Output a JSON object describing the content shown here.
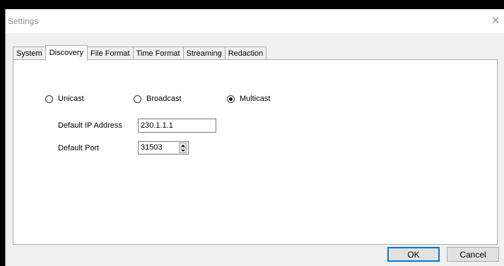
{
  "window": {
    "title": "Settings",
    "close_glyph": "✕"
  },
  "tabs": [
    {
      "label": "System",
      "active": false
    },
    {
      "label": "Discovery",
      "active": true
    },
    {
      "label": "File Format",
      "active": false
    },
    {
      "label": "Time Format",
      "active": false
    },
    {
      "label": "Streaming",
      "active": false
    },
    {
      "label": "Redaction",
      "active": false
    }
  ],
  "discovery": {
    "modes": [
      {
        "label": "Unicast",
        "selected": false
      },
      {
        "label": "Broadcast",
        "selected": false
      },
      {
        "label": "Multicast",
        "selected": true
      }
    ],
    "ip_label": "Default IP Address",
    "ip_value": "230.1.1.1",
    "port_label": "Default Port",
    "port_value": "31503"
  },
  "buttons": {
    "ok": "OK",
    "cancel": "Cancel"
  },
  "colors": {
    "accent": "#0078d7",
    "background": "#f0f0f0",
    "panel": "#ffffff"
  }
}
